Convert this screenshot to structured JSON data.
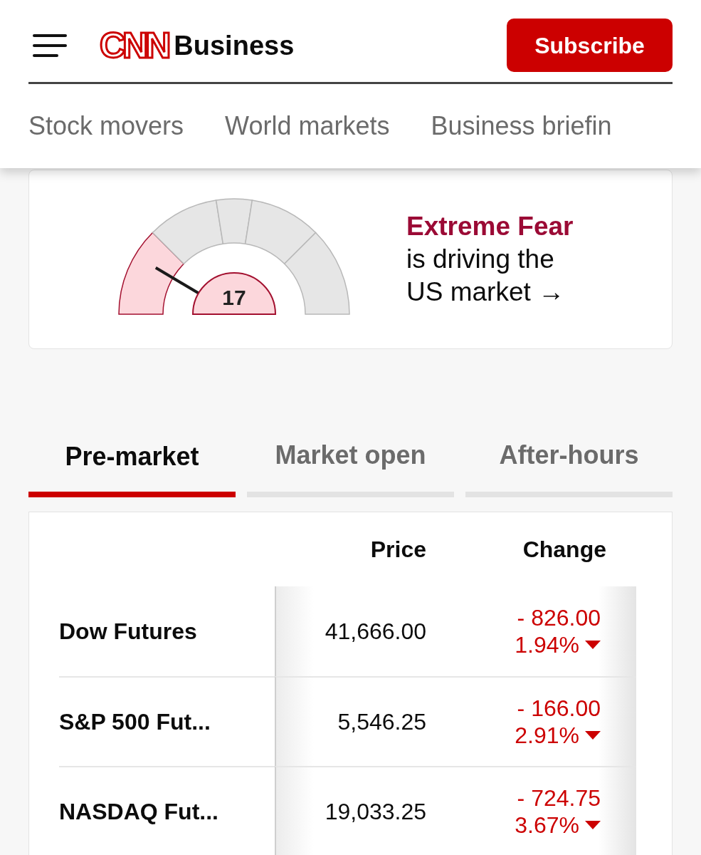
{
  "header": {
    "logo": "CNN",
    "section": "Business",
    "subscribe": "Subscribe"
  },
  "nav": [
    "Stock movers",
    "World markets",
    "Business briefin"
  ],
  "fear_greed": {
    "score": "17",
    "headline_strong": "Extreme Fear",
    "headline_rest": "is driving the US market",
    "arrow": "→"
  },
  "tabs": [
    {
      "label": "Pre-market",
      "selected": true
    },
    {
      "label": "Market open",
      "selected": false
    },
    {
      "label": "After-hours",
      "selected": false
    }
  ],
  "table": {
    "columns": [
      "Price",
      "Change"
    ],
    "rows": [
      {
        "name": "Dow Futures",
        "price": "41,666.00",
        "change": "- 826.00",
        "percent": "1.94%",
        "falling": true
      },
      {
        "name": "S&P 500 Fut...",
        "price": "5,546.25",
        "change": "- 166.00",
        "percent": "2.91%",
        "falling": true
      },
      {
        "name": "NASDAQ Fut...",
        "price": "19,033.25",
        "change": "- 724.75",
        "percent": "3.67%",
        "falling": true
      }
    ]
  }
}
